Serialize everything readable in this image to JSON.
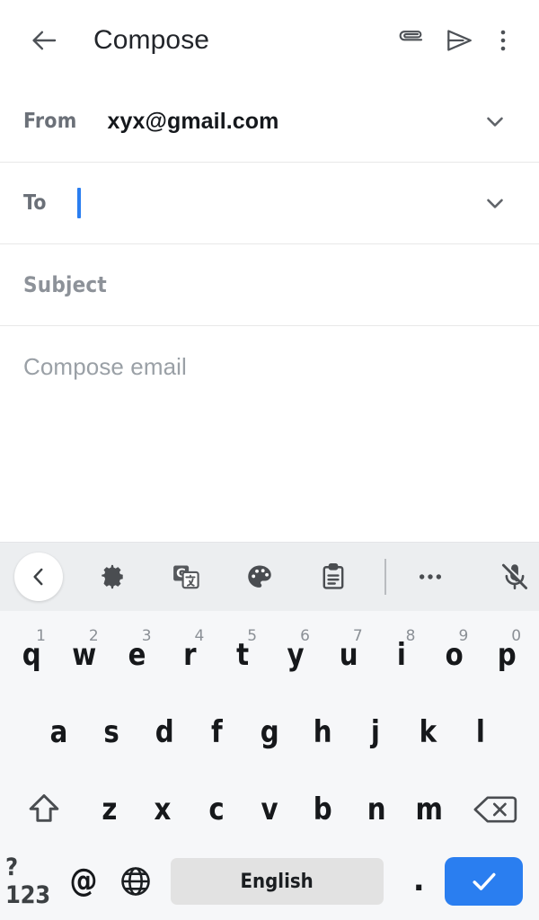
{
  "appbar": {
    "back_icon": "arrow-left-icon",
    "title": "Compose",
    "attach_icon": "paperclip-icon",
    "send_icon": "send-icon",
    "menu_icon": "more-vertical-icon"
  },
  "form": {
    "from": {
      "label": "From",
      "value": "xyx@gmail.com",
      "chevron_icon": "chevron-down-icon"
    },
    "to": {
      "label": "To",
      "value": "",
      "chevron_icon": "chevron-down-icon",
      "caret_color": "#2a7ef0"
    },
    "subject": {
      "placeholder": "Subject"
    },
    "body": {
      "placeholder": "Compose email"
    }
  },
  "keyboard": {
    "toolbar": {
      "items": [
        {
          "name": "back-chevron-icon",
          "label": ""
        },
        {
          "name": "settings-gear-icon",
          "label": ""
        },
        {
          "name": "google-translate-icon",
          "label": ""
        },
        {
          "name": "theme-palette-icon",
          "label": ""
        },
        {
          "name": "clipboard-icon",
          "label": ""
        },
        {
          "name": "more-horizontal-icon",
          "label": ""
        },
        {
          "name": "mic-off-icon",
          "label": ""
        }
      ]
    },
    "row1": [
      {
        "letter": "q",
        "hint": "1"
      },
      {
        "letter": "w",
        "hint": "2"
      },
      {
        "letter": "e",
        "hint": "3"
      },
      {
        "letter": "r",
        "hint": "4"
      },
      {
        "letter": "t",
        "hint": "5"
      },
      {
        "letter": "y",
        "hint": "6"
      },
      {
        "letter": "u",
        "hint": "7"
      },
      {
        "letter": "i",
        "hint": "8"
      },
      {
        "letter": "o",
        "hint": "9"
      },
      {
        "letter": "p",
        "hint": "0"
      }
    ],
    "row2": [
      {
        "letter": "a"
      },
      {
        "letter": "s"
      },
      {
        "letter": "d"
      },
      {
        "letter": "f"
      },
      {
        "letter": "g"
      },
      {
        "letter": "h"
      },
      {
        "letter": "j"
      },
      {
        "letter": "k"
      },
      {
        "letter": "l"
      }
    ],
    "row3": [
      {
        "letter": "z"
      },
      {
        "letter": "x"
      },
      {
        "letter": "c"
      },
      {
        "letter": "v"
      },
      {
        "letter": "b"
      },
      {
        "letter": "n"
      },
      {
        "letter": "m"
      }
    ],
    "shift_icon": "shift-arrow-up-icon",
    "backspace_icon": "backspace-icon",
    "row4": {
      "symbols_label": "?123",
      "at_label": "@",
      "globe_icon": "globe-language-icon",
      "space_label": "English",
      "period_label": ".",
      "enter_icon": "check-icon",
      "enter_color": "#2a7ef0"
    }
  }
}
